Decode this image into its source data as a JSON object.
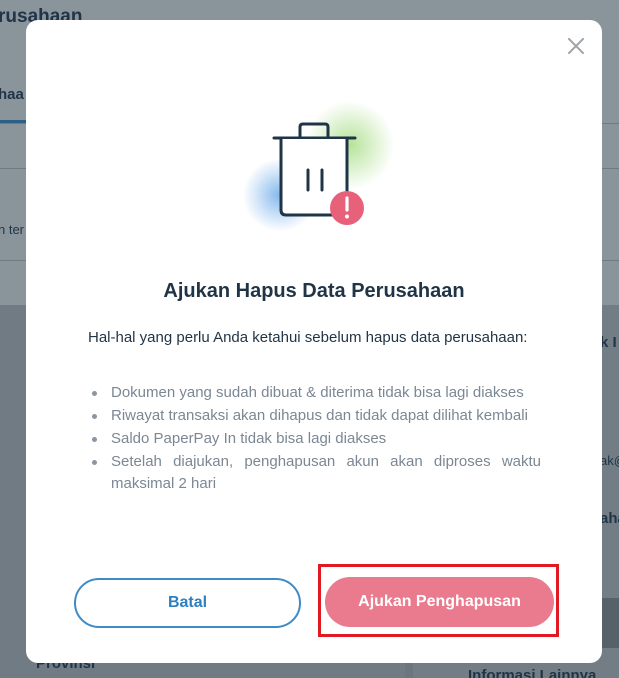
{
  "background": {
    "page_title": "rusahaan",
    "tab_label": "haa",
    "field_text": "n ter",
    "right_label": "k I",
    "right_email": "ak@",
    "right_label2": "aha",
    "province_label": "Provinsi",
    "info_label": "Informasi Lainnya"
  },
  "modal": {
    "title": "Ajukan Hapus Data Perusahaan",
    "intro": "Hal-hal yang perlu Anda ketahui sebelum hapus data perusahaan:",
    "points": [
      "Dokumen yang sudah dibuat & diterima tidak bisa lagi diakses",
      "Riwayat transaksi akan dihapus dan tidak dapat dilihat kembali",
      "Saldo PaperPay In tidak bisa lagi diakses",
      "Setelah diajukan, penghapusan akun akan diproses waktu maksimal 2 hari"
    ],
    "cancel_label": "Batal",
    "submit_label": "Ajukan Penghapusan",
    "illustration_icon": "trash-warning-icon",
    "close_icon": "close-icon",
    "colors": {
      "primary": "#2e7fbf",
      "danger": "#ea7a8e",
      "highlight": "#e01923",
      "title": "#1f3446"
    }
  }
}
